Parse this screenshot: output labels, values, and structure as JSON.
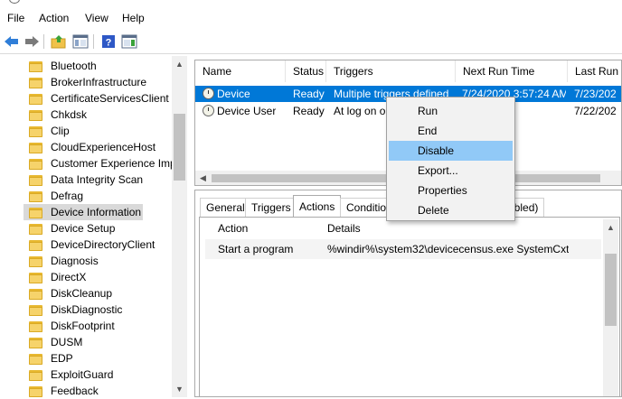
{
  "menu": [
    "File",
    "Action",
    "View",
    "Help"
  ],
  "tree": {
    "items": [
      "Bluetooth",
      "BrokerInfrastructure",
      "CertificateServicesClient",
      "Chkdsk",
      "Clip",
      "CloudExperienceHost",
      "Customer Experience Imp",
      "Data Integrity Scan",
      "Defrag",
      "Device Information",
      "Device Setup",
      "DeviceDirectoryClient",
      "Diagnosis",
      "DirectX",
      "DiskCleanup",
      "DiskDiagnostic",
      "DiskFootprint",
      "DUSM",
      "EDP",
      "ExploitGuard",
      "Feedback"
    ],
    "selected": "Device Information"
  },
  "tasks": {
    "columns": [
      "Name",
      "Status",
      "Triggers",
      "Next Run Time",
      "Last Run"
    ],
    "rows": [
      {
        "name": "Device",
        "status": "Ready",
        "triggers": "Multiple triggers defined",
        "next": "7/24/2020 3:57:24 AM",
        "last": "7/23/202"
      },
      {
        "name": "Device User",
        "status": "Ready",
        "triggers": "At log on o",
        "next": "",
        "last": "7/22/202"
      }
    ]
  },
  "tabs": [
    "General",
    "Triggers",
    "Actions",
    "Conditio",
    "abled)"
  ],
  "active_tab": "Actions",
  "actions_table": {
    "columns": [
      "Action",
      "Details"
    ],
    "rows": [
      {
        "action": "Start a program",
        "details": "%windir%\\system32\\devicecensus.exe SystemCxt"
      }
    ]
  },
  "context_menu": {
    "items": [
      "Run",
      "End",
      "Disable",
      "Export...",
      "Properties",
      "Delete"
    ],
    "highlighted": "Disable"
  },
  "colors": {
    "selection": "#0078d7",
    "menu_highlight": "#91c9f7",
    "folder": "#f6d36b"
  }
}
